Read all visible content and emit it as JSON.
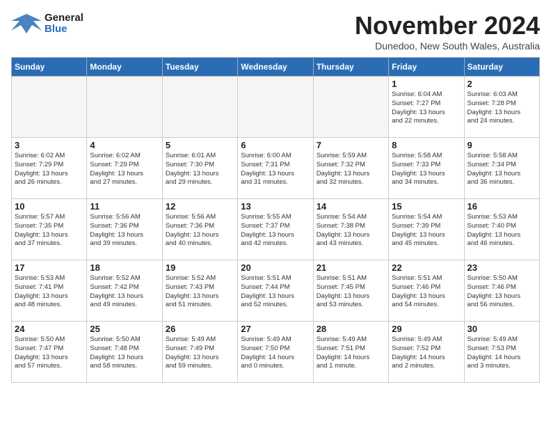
{
  "header": {
    "logo": {
      "general": "General",
      "blue": "Blue"
    },
    "title": "November 2024",
    "subtitle": "Dunedoo, New South Wales, Australia"
  },
  "weekdays": [
    "Sunday",
    "Monday",
    "Tuesday",
    "Wednesday",
    "Thursday",
    "Friday",
    "Saturday"
  ],
  "weeks": [
    [
      {
        "day": "",
        "info": ""
      },
      {
        "day": "",
        "info": ""
      },
      {
        "day": "",
        "info": ""
      },
      {
        "day": "",
        "info": ""
      },
      {
        "day": "",
        "info": ""
      },
      {
        "day": "1",
        "info": "Sunrise: 6:04 AM\nSunset: 7:27 PM\nDaylight: 13 hours\nand 22 minutes."
      },
      {
        "day": "2",
        "info": "Sunrise: 6:03 AM\nSunset: 7:28 PM\nDaylight: 13 hours\nand 24 minutes."
      }
    ],
    [
      {
        "day": "3",
        "info": "Sunrise: 6:02 AM\nSunset: 7:29 PM\nDaylight: 13 hours\nand 26 minutes."
      },
      {
        "day": "4",
        "info": "Sunrise: 6:02 AM\nSunset: 7:29 PM\nDaylight: 13 hours\nand 27 minutes."
      },
      {
        "day": "5",
        "info": "Sunrise: 6:01 AM\nSunset: 7:30 PM\nDaylight: 13 hours\nand 29 minutes."
      },
      {
        "day": "6",
        "info": "Sunrise: 6:00 AM\nSunset: 7:31 PM\nDaylight: 13 hours\nand 31 minutes."
      },
      {
        "day": "7",
        "info": "Sunrise: 5:59 AM\nSunset: 7:32 PM\nDaylight: 13 hours\nand 32 minutes."
      },
      {
        "day": "8",
        "info": "Sunrise: 5:58 AM\nSunset: 7:33 PM\nDaylight: 13 hours\nand 34 minutes."
      },
      {
        "day": "9",
        "info": "Sunrise: 5:58 AM\nSunset: 7:34 PM\nDaylight: 13 hours\nand 36 minutes."
      }
    ],
    [
      {
        "day": "10",
        "info": "Sunrise: 5:57 AM\nSunset: 7:35 PM\nDaylight: 13 hours\nand 37 minutes."
      },
      {
        "day": "11",
        "info": "Sunrise: 5:56 AM\nSunset: 7:36 PM\nDaylight: 13 hours\nand 39 minutes."
      },
      {
        "day": "12",
        "info": "Sunrise: 5:56 AM\nSunset: 7:36 PM\nDaylight: 13 hours\nand 40 minutes."
      },
      {
        "day": "13",
        "info": "Sunrise: 5:55 AM\nSunset: 7:37 PM\nDaylight: 13 hours\nand 42 minutes."
      },
      {
        "day": "14",
        "info": "Sunrise: 5:54 AM\nSunset: 7:38 PM\nDaylight: 13 hours\nand 43 minutes."
      },
      {
        "day": "15",
        "info": "Sunrise: 5:54 AM\nSunset: 7:39 PM\nDaylight: 13 hours\nand 45 minutes."
      },
      {
        "day": "16",
        "info": "Sunrise: 5:53 AM\nSunset: 7:40 PM\nDaylight: 13 hours\nand 46 minutes."
      }
    ],
    [
      {
        "day": "17",
        "info": "Sunrise: 5:53 AM\nSunset: 7:41 PM\nDaylight: 13 hours\nand 48 minutes."
      },
      {
        "day": "18",
        "info": "Sunrise: 5:52 AM\nSunset: 7:42 PM\nDaylight: 13 hours\nand 49 minutes."
      },
      {
        "day": "19",
        "info": "Sunrise: 5:52 AM\nSunset: 7:43 PM\nDaylight: 13 hours\nand 51 minutes."
      },
      {
        "day": "20",
        "info": "Sunrise: 5:51 AM\nSunset: 7:44 PM\nDaylight: 13 hours\nand 52 minutes."
      },
      {
        "day": "21",
        "info": "Sunrise: 5:51 AM\nSunset: 7:45 PM\nDaylight: 13 hours\nand 53 minutes."
      },
      {
        "day": "22",
        "info": "Sunrise: 5:51 AM\nSunset: 7:46 PM\nDaylight: 13 hours\nand 54 minutes."
      },
      {
        "day": "23",
        "info": "Sunrise: 5:50 AM\nSunset: 7:46 PM\nDaylight: 13 hours\nand 56 minutes."
      }
    ],
    [
      {
        "day": "24",
        "info": "Sunrise: 5:50 AM\nSunset: 7:47 PM\nDaylight: 13 hours\nand 57 minutes."
      },
      {
        "day": "25",
        "info": "Sunrise: 5:50 AM\nSunset: 7:48 PM\nDaylight: 13 hours\nand 58 minutes."
      },
      {
        "day": "26",
        "info": "Sunrise: 5:49 AM\nSunset: 7:49 PM\nDaylight: 13 hours\nand 59 minutes."
      },
      {
        "day": "27",
        "info": "Sunrise: 5:49 AM\nSunset: 7:50 PM\nDaylight: 14 hours\nand 0 minutes."
      },
      {
        "day": "28",
        "info": "Sunrise: 5:49 AM\nSunset: 7:51 PM\nDaylight: 14 hours\nand 1 minute."
      },
      {
        "day": "29",
        "info": "Sunrise: 5:49 AM\nSunset: 7:52 PM\nDaylight: 14 hours\nand 2 minutes."
      },
      {
        "day": "30",
        "info": "Sunrise: 5:49 AM\nSunset: 7:53 PM\nDaylight: 14 hours\nand 3 minutes."
      }
    ]
  ]
}
